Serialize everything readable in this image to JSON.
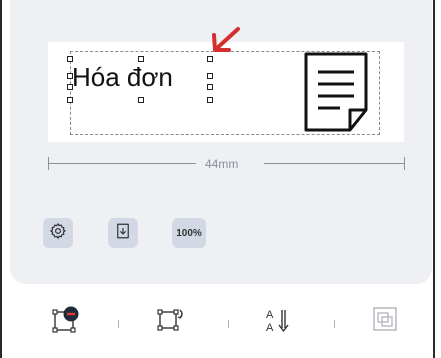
{
  "label": {
    "text": "Hóa đơn"
  },
  "dimension": {
    "width_label": "44mm"
  },
  "toolbar": {
    "zoom_label": "100%"
  },
  "icons": {
    "document": "document-icon",
    "settings": "gear-icon",
    "download": "download-icon",
    "remove_element": "remove-element-icon",
    "rotate": "rotate-icon",
    "text_size": "text-size-icon",
    "layers": "layers-icon"
  },
  "colors": {
    "accent_arrow": "#d32f2f",
    "panel_bg": "#eef0f4",
    "button_bg": "#d3d9e4"
  }
}
